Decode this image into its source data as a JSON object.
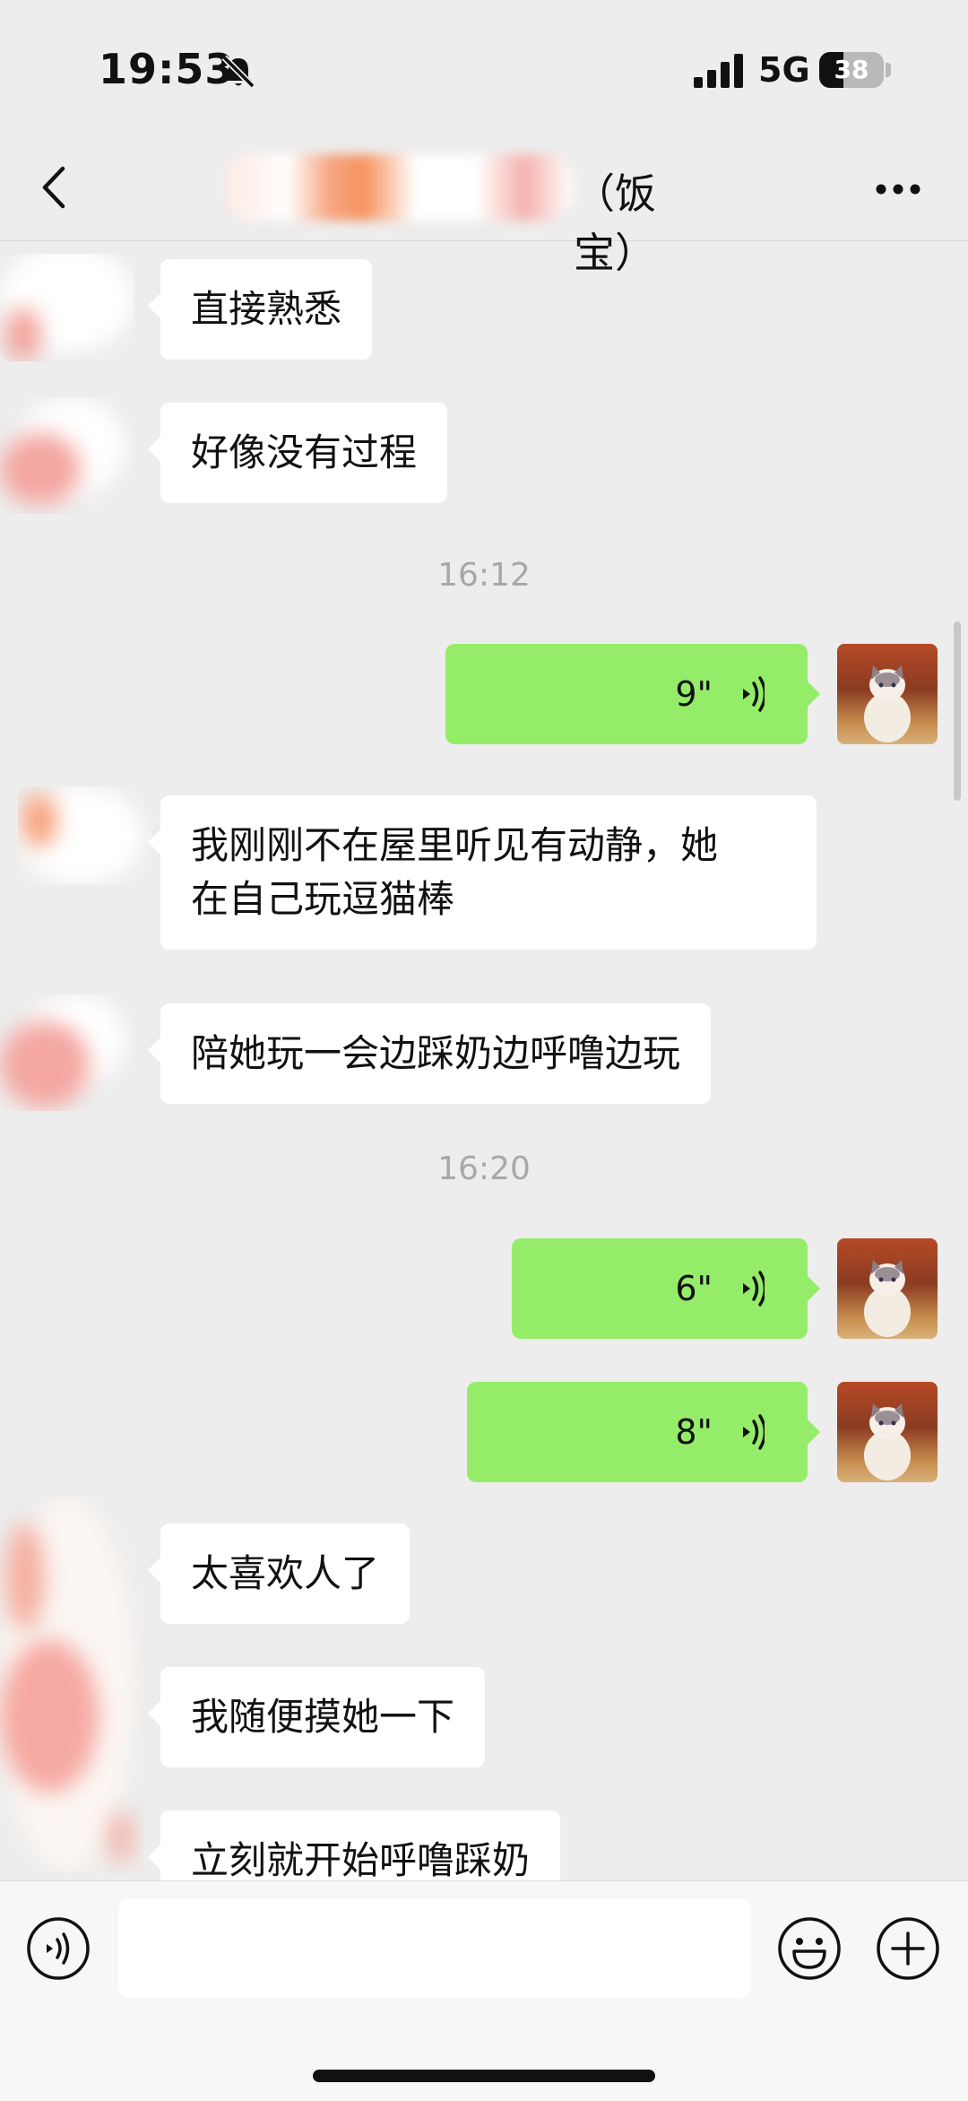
{
  "status_bar": {
    "time": "19:53",
    "network": "5G",
    "battery": "38",
    "battery_level": 0.38
  },
  "nav": {
    "title_suffix": "（饭宝）"
  },
  "messages": [
    {
      "text": "直接熟悉"
    },
    {
      "text": "好像没有过程"
    },
    {
      "timestamp": "16:12"
    },
    {
      "voice_duration": "9\""
    },
    {
      "text": "我刚刚不在屋里听见有动静，她\n在自己玩逗猫棒"
    },
    {
      "text": "陪她玩一会边踩奶边呼噜边玩"
    },
    {
      "timestamp": "16:20"
    },
    {
      "voice_duration": "6\""
    },
    {
      "voice_duration": "8\""
    },
    {
      "text": "太喜欢人了"
    },
    {
      "text": "我随便摸她一下"
    },
    {
      "text": "立刻就开始呼噜踩奶"
    }
  ],
  "input": {
    "value": ""
  },
  "colors": {
    "outgoing_bubble": "#95ec69",
    "incoming_bubble": "#ffffff",
    "background": "#ededed",
    "timestamp": "#a8a8a8"
  },
  "icons": [
    "bell-muted-icon",
    "signal-icon",
    "battery-icon",
    "back-arrow-icon",
    "more-dots-icon",
    "voice-wave-icon",
    "voice-input-icon",
    "emoji-icon",
    "plus-icon"
  ]
}
